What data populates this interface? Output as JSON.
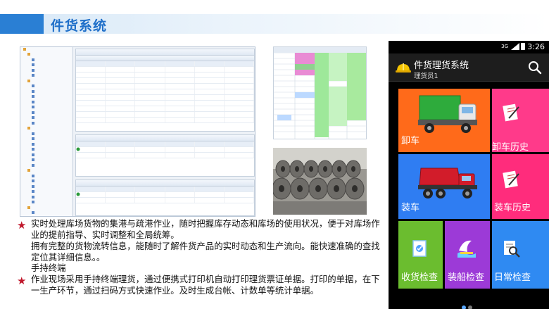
{
  "header": {
    "title": "件货系统"
  },
  "body_text": {
    "p1": "实时处理库场货物的集港与疏港作业，随时把握库存动态和库场的使用状况，便于对库场作业的提前指导、实时调整和全局统筹。",
    "p2": "拥有完整的货物流转信息，能随时了解件货产品的实时动态和生产流向。能快速准确的查找定位其详细信息。。",
    "p3": "手持终端",
    "p4": "作业现场采用手持终端理货，通过便携式打印机自动打印理货票证单据。打印的单据，在下一生产环节，通过扫码方式快速作业。及时生成台帐、计数单等统计单据。"
  },
  "phone": {
    "status_time": "3:26",
    "status_signal": "3G",
    "app_title": "件货理货系统",
    "app_subtitle": "理货员1",
    "tiles": [
      {
        "label": "卸车",
        "color": "#ff6a1a"
      },
      {
        "label": "卸车历史",
        "color": "#ff3a8a"
      },
      {
        "label": "装车",
        "color": "#2f7df2"
      },
      {
        "label": "装车历史",
        "color": "#ff2c7c"
      },
      {
        "label": "收货检查",
        "color": "#6bbd2f"
      },
      {
        "label": "装船检查",
        "color": "#9c3ad7"
      },
      {
        "label": "日常检查",
        "color": "#2f8af2"
      }
    ],
    "page_dots": 2
  },
  "colors": {
    "accent": "#1f6fc9",
    "star": "#c0172b"
  }
}
